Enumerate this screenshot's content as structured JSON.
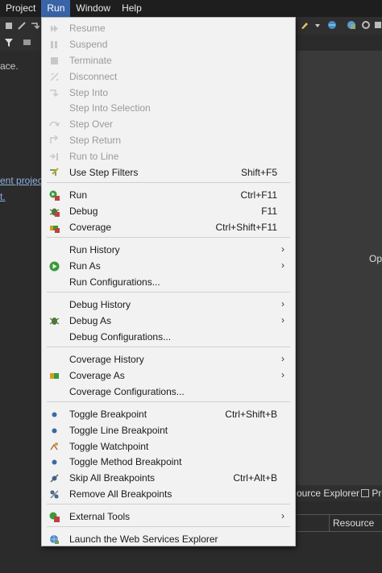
{
  "menubar": {
    "items": [
      {
        "label": "Project"
      },
      {
        "label": "Run",
        "active": true
      },
      {
        "label": "Window"
      },
      {
        "label": "Help"
      }
    ]
  },
  "left_panel": {
    "line1": "ace.",
    "link1": "ent project",
    "link2": "t."
  },
  "editor": {
    "text": "Op"
  },
  "bottom": {
    "tab1": "ource Explorer",
    "tab2": "Pre",
    "column_header": "Resource"
  },
  "run_menu": {
    "items": [
      {
        "label": "Resume",
        "enabled": false,
        "icon": "resume-icon"
      },
      {
        "label": "Suspend",
        "enabled": false,
        "icon": "suspend-icon"
      },
      {
        "label": "Terminate",
        "enabled": false,
        "icon": "terminate-icon"
      },
      {
        "label": "Disconnect",
        "enabled": false,
        "icon": "disconnect-icon"
      },
      {
        "label": "Step Into",
        "enabled": false,
        "icon": "step-into-icon"
      },
      {
        "label": "Step Into Selection",
        "enabled": false,
        "icon": "none"
      },
      {
        "label": "Step Over",
        "enabled": false,
        "icon": "step-over-icon"
      },
      {
        "label": "Step Return",
        "enabled": false,
        "icon": "step-return-icon"
      },
      {
        "label": "Run to Line",
        "enabled": false,
        "icon": "run-to-line-icon"
      },
      {
        "label": "Use Step Filters",
        "shortcut": "Shift+F5",
        "enabled": true,
        "icon": "step-filters-icon"
      },
      {
        "label": "Run",
        "shortcut": "Ctrl+F11",
        "enabled": true,
        "icon": "run-icon"
      },
      {
        "label": "Debug",
        "shortcut": "F11",
        "enabled": true,
        "icon": "debug-icon"
      },
      {
        "label": "Coverage",
        "shortcut": "Ctrl+Shift+F11",
        "enabled": true,
        "icon": "coverage-icon"
      },
      {
        "label": "Run History",
        "submenu": true,
        "enabled": true,
        "icon": "none"
      },
      {
        "label": "Run As",
        "submenu": true,
        "enabled": true,
        "icon": "run-as-icon"
      },
      {
        "label": "Run Configurations...",
        "enabled": true,
        "icon": "none"
      },
      {
        "label": "Debug History",
        "submenu": true,
        "enabled": true,
        "icon": "none"
      },
      {
        "label": "Debug As",
        "submenu": true,
        "enabled": true,
        "icon": "debug-as-icon"
      },
      {
        "label": "Debug Configurations...",
        "enabled": true,
        "icon": "none"
      },
      {
        "label": "Coverage History",
        "submenu": true,
        "enabled": true,
        "icon": "none"
      },
      {
        "label": "Coverage As",
        "submenu": true,
        "enabled": true,
        "icon": "coverage-as-icon"
      },
      {
        "label": "Coverage Configurations...",
        "enabled": true,
        "icon": "none"
      },
      {
        "label": "Toggle Breakpoint",
        "shortcut": "Ctrl+Shift+B",
        "enabled": true,
        "icon": "breakpoint-icon"
      },
      {
        "label": "Toggle Line Breakpoint",
        "enabled": true,
        "icon": "line-breakpoint-icon"
      },
      {
        "label": "Toggle Watchpoint",
        "enabled": true,
        "icon": "watchpoint-icon"
      },
      {
        "label": "Toggle Method Breakpoint",
        "enabled": true,
        "icon": "method-breakpoint-icon"
      },
      {
        "label": "Skip All Breakpoints",
        "shortcut": "Ctrl+Alt+B",
        "enabled": true,
        "icon": "skip-breakpoints-icon"
      },
      {
        "label": "Remove All Breakpoints",
        "enabled": true,
        "icon": "remove-breakpoints-icon"
      },
      {
        "label": "External Tools",
        "submenu": true,
        "enabled": true,
        "icon": "external-tools-icon"
      },
      {
        "label": "Launch the Web Services Explorer",
        "enabled": true,
        "icon": "web-services-icon"
      }
    ]
  },
  "colors": {
    "menu_bg": "#f2f2f2",
    "active_menubar": "#3a64a8",
    "disabled_text": "#9a9a9a",
    "run_green": "#3a9a3a"
  }
}
